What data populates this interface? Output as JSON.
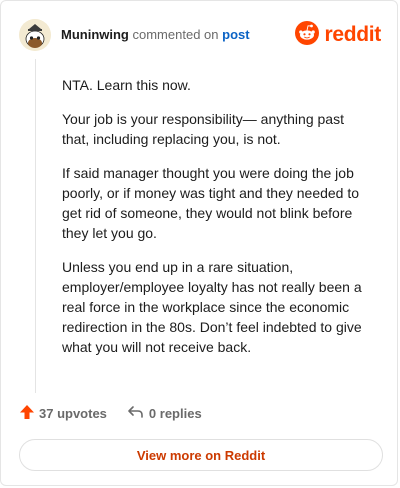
{
  "header": {
    "username": "Muninwing",
    "action_text": "commented on",
    "post_link": "post",
    "brand_name": "reddit"
  },
  "comment": {
    "paragraphs": [
      "NTA. Learn this now.",
      "Your job is your responsibility— anything past that, including replacing you, is not.",
      "If said manager thought you were doing the job poorly, or if money was tight and they needed to get rid of someone, they would not blink before they let you go.",
      "Unless you end up in a rare situation, employer/employee loyalty has not really been a real force in the workplace since the economic redirection in the 80s. Don’t feel indebted to give what you will not receive back."
    ]
  },
  "actions": {
    "upvotes_label": "37 upvotes",
    "replies_label": "0 replies"
  },
  "footer": {
    "more_button_label": "View more on Reddit"
  },
  "icons": {
    "avatar": "snoo-avatar-icon",
    "brand": "reddit-logo-icon",
    "upvote": "upvote-arrow-icon",
    "reply": "reply-arrow-icon"
  },
  "colors": {
    "brand_orange": "#ff4500",
    "link_blue": "#0b63c5",
    "button_text": "#cc3a00",
    "muted_text": "#6a6a6a"
  }
}
